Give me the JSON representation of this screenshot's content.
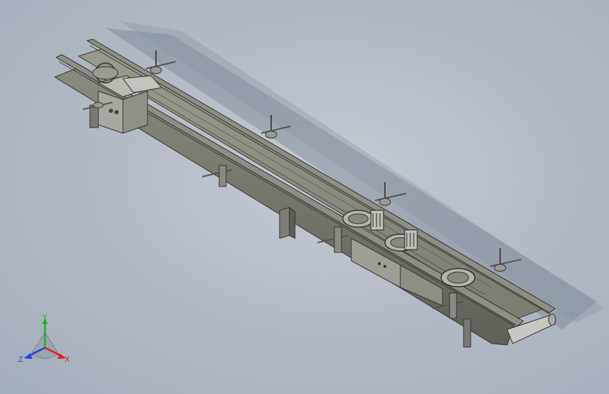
{
  "viewport": {
    "background": "#b4bbc6",
    "model": "conveyor-assembly"
  },
  "triad": {
    "x_label": "X",
    "y_label": "Y",
    "z_label": "Z",
    "x_color": "#e02020",
    "y_color": "#20b020",
    "z_color": "#2040e0"
  }
}
